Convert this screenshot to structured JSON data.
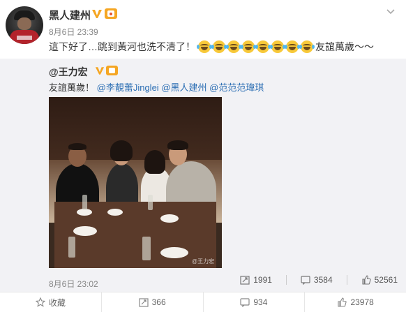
{
  "post": {
    "author": "黑人建州",
    "time": "8月6日 23:39",
    "text_before": "這下好了…跳到黃河也洗不清了！",
    "emoji_count": 8,
    "text_after": "友誼萬歲～～"
  },
  "repost": {
    "author": "@王力宏",
    "text_prefix": "友誼萬歲！",
    "mentions": [
      "@李靚蕾Jinglei",
      "@黑人建州",
      "@范范范瑋琪"
    ],
    "watermark": "@王力宏",
    "time": "8月6日 23:02",
    "stats": {
      "reposts": "1991",
      "comments": "3584",
      "likes": "52561"
    }
  },
  "footer": {
    "favorite_label": "收藏",
    "reposts": "366",
    "comments": "934",
    "likes": "23978"
  },
  "colors": {
    "link": "#2a6db3",
    "verified": "#f5a623",
    "repost_bg": "#f2f2f5"
  }
}
